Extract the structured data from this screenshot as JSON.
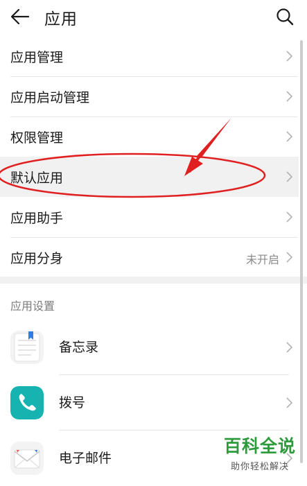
{
  "header": {
    "title": "应用",
    "back_icon": "arrow-left-icon",
    "search_icon": "search-icon"
  },
  "settings_items": [
    {
      "label": "应用管理"
    },
    {
      "label": "应用启动管理"
    },
    {
      "label": "权限管理"
    },
    {
      "label": "默认应用",
      "highlighted": true
    },
    {
      "label": "应用助手"
    },
    {
      "label": "应用分身",
      "value": "未开启"
    }
  ],
  "section": {
    "title": "应用设置"
  },
  "apps": [
    {
      "label": "备忘录",
      "icon": "notepad-icon"
    },
    {
      "label": "拨号",
      "icon": "phone-icon",
      "icon_color": "#17b3b0"
    },
    {
      "label": "电子邮件",
      "icon": "mail-icon"
    }
  ],
  "annotation": {
    "color": "#e02020"
  },
  "watermark": {
    "main": "百科全说",
    "sub": "助你轻松解决",
    "color": "#2d9a3c"
  }
}
